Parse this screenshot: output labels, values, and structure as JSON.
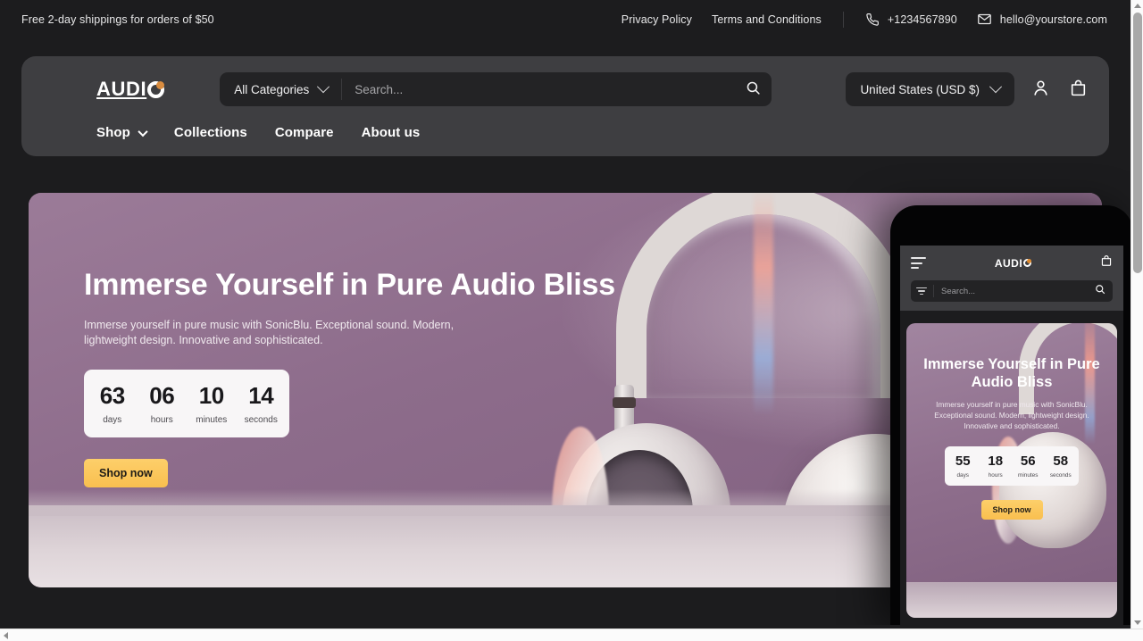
{
  "announcement": {
    "shipping_text": "Free 2-day shippings for orders of $50",
    "links": [
      {
        "label": "Privacy Policy",
        "name": "privacy-policy-link"
      },
      {
        "label": "Terms and Conditions",
        "name": "terms-and-conditions-link"
      }
    ],
    "phone": "+1234567890",
    "email": "hello@yourstore.com",
    "phone_icon": "phone-icon",
    "email_icon": "envelope-icon"
  },
  "header": {
    "logo_text": "AUDI",
    "logo_accent_color": "#d98c3f",
    "category_select": {
      "selected": "All Categories",
      "chevron_icon": "chevron-down-icon"
    },
    "search": {
      "value": "",
      "placeholder": "Search...",
      "icon": "search-icon"
    },
    "country_select": {
      "selected": "United States (USD $)",
      "chevron_icon": "chevron-down-icon"
    },
    "account_icon": "user-icon",
    "cart_icon": "shopping-bag-icon",
    "nav": [
      {
        "label": "Shop",
        "has_dropdown": true
      },
      {
        "label": "Collections",
        "has_dropdown": false
      },
      {
        "label": "Compare",
        "has_dropdown": false
      },
      {
        "label": "About us",
        "has_dropdown": false
      }
    ]
  },
  "hero": {
    "title": "Immerse Yourself in Pure Audio Bliss",
    "subtitle": "Immerse yourself in pure music with SonicBlu. Exceptional sound. Modern, lightweight design. Innovative and sophisticated.",
    "countdown": [
      {
        "value": "63",
        "label": "days"
      },
      {
        "value": "06",
        "label": "hours"
      },
      {
        "value": "10",
        "label": "minutes"
      },
      {
        "value": "14",
        "label": "seconds"
      }
    ],
    "cta_label": "Shop now",
    "cta_color": "#f9bf4f",
    "background_color": "#8e6d8c"
  },
  "mobile_preview": {
    "menu_icon": "hamburger-menu-icon",
    "logo_text": "AUDI",
    "cart_icon": "shopping-bag-icon",
    "filter_icon": "filter-icon",
    "search": {
      "value": "",
      "placeholder": "Search...",
      "icon": "search-icon"
    },
    "hero": {
      "title": "Immerse Yourself in Pure Audio Bliss",
      "subtitle": "Immerse yourself in pure music with SonicBlu. Exceptional sound. Modern, lightweight design. Innovative and sophisticated.",
      "countdown": [
        {
          "value": "55",
          "label": "days"
        },
        {
          "value": "18",
          "label": "hours"
        },
        {
          "value": "56",
          "label": "minutes"
        },
        {
          "value": "58",
          "label": "seconds"
        }
      ],
      "cta_label": "Shop now"
    }
  }
}
